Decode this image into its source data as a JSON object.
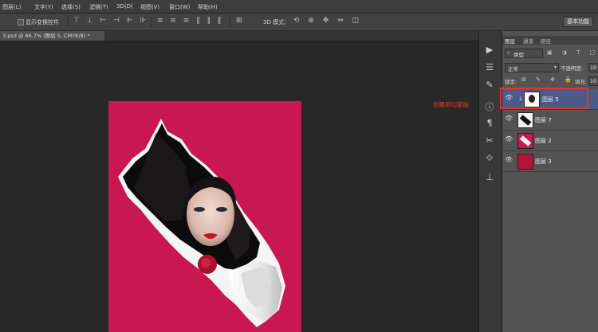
{
  "menu": [
    "图层(L)",
    "文字(Y)",
    "选择(S)",
    "滤镜(T)",
    "3D(D)",
    "视图(V)",
    "窗口(W)",
    "帮助(H)"
  ],
  "options": {
    "show_transform_label": "显示变换控件",
    "mode_label": "3D 模式：",
    "workspace_label": "基本功能"
  },
  "document_tab": "3.psd @ 66.7% (图层 5, CMYK/8) *",
  "panel_tabs": [
    "图层",
    "通道",
    "路径"
  ],
  "panel": {
    "filter_kind": "类型",
    "blend_mode": "正常",
    "opacity_label": "不透明度:",
    "opacity_value": "10",
    "lock_label": "锁定:",
    "fill_label": "填充:",
    "fill_value": "10"
  },
  "layers": [
    {
      "name": "图层 5",
      "selected": true,
      "clipped": true
    },
    {
      "name": "图层 7",
      "selected": false,
      "clipped": false
    },
    {
      "name": "图层 2",
      "selected": false,
      "clipped": false
    },
    {
      "name": "图层 3",
      "selected": false,
      "clipped": false
    }
  ],
  "annotation": "创建剪切蒙版",
  "colors": {
    "document_bg": "#c9174f",
    "selection": "#4b5a86",
    "annotation": "#e63b2e"
  }
}
